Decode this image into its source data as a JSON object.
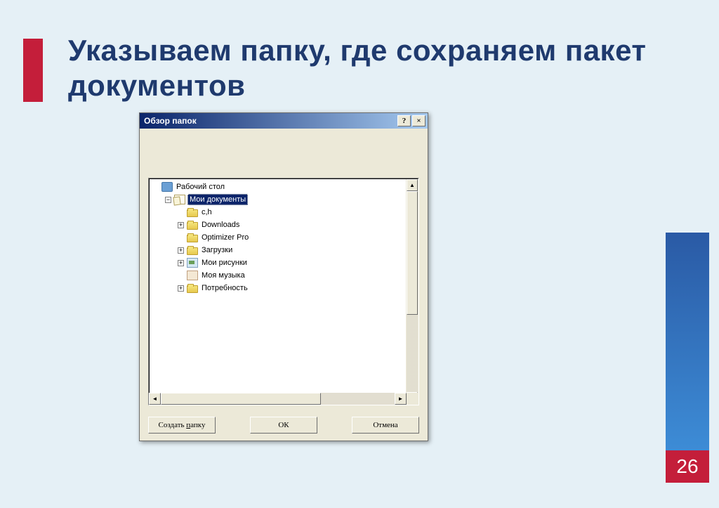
{
  "slide": {
    "title": "Указываем папку, где сохраняем пакет документов",
    "page_number": "26"
  },
  "dialog": {
    "title": "Обзор папок",
    "help_symbol": "?",
    "close_symbol": "×",
    "tree": {
      "desktop": "Рабочий стол",
      "mydocs": "Мои документы",
      "items": [
        {
          "label": "с,h",
          "expand": "none",
          "icon": "folder"
        },
        {
          "label": "Downloads",
          "expand": "plus",
          "icon": "folder"
        },
        {
          "label": "Optimizer Pro",
          "expand": "none",
          "icon": "folder"
        },
        {
          "label": "Загрузки",
          "expand": "plus",
          "icon": "folder"
        },
        {
          "label": "Мои рисунки",
          "expand": "plus",
          "icon": "pictures"
        },
        {
          "label": "Моя музыка",
          "expand": "none",
          "icon": "music"
        },
        {
          "label": "Потребность",
          "expand": "plus",
          "icon": "folder"
        }
      ]
    },
    "buttons": {
      "new_folder_prefix": "Создать ",
      "new_folder_u": "п",
      "new_folder_suffix": "апку",
      "ok": "ОК",
      "cancel": "Отмена"
    }
  }
}
